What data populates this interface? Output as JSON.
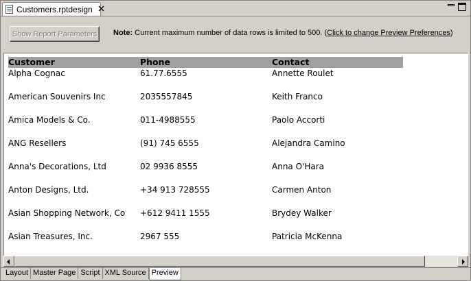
{
  "editor_tab": {
    "title": "Customers.rptdesign"
  },
  "toolbar": {
    "params_button": "Show Report Parameters",
    "note_label": "Note:",
    "note_text": "Current maximum number of data rows is limited to 500. (",
    "note_link": "Click to change Preview Preferences",
    "note_close": ")"
  },
  "report": {
    "columns": [
      "Customer",
      "Phone",
      "Contact"
    ],
    "rows": [
      [
        "Alpha Cognac",
        "61.77.6555",
        "Annette  Roulet"
      ],
      [
        "American Souvenirs Inc",
        "2035557845",
        "Keith Franco"
      ],
      [
        "Amica Models & Co.",
        "011-4988555",
        "Paolo  Accorti"
      ],
      [
        "ANG Resellers",
        "(91) 745 6555",
        "Alejandra  Camino"
      ],
      [
        "Anna's Decorations, Ltd",
        "02 9936 8555",
        "Anna O'Hara"
      ],
      [
        "Anton Designs, Ltd.",
        "+34 913 728555",
        "Carmen Anton"
      ],
      [
        "Asian Shopping Network, Co",
        "+612 9411 1555",
        "Brydey Walker"
      ],
      [
        "Asian Treasures, Inc.",
        "2967 555",
        "Patricia  McKenna"
      ]
    ]
  },
  "bottom_tabs": [
    "Layout",
    "Master Page",
    "Script",
    "XML Source",
    "Preview"
  ],
  "active_tab": "Preview"
}
